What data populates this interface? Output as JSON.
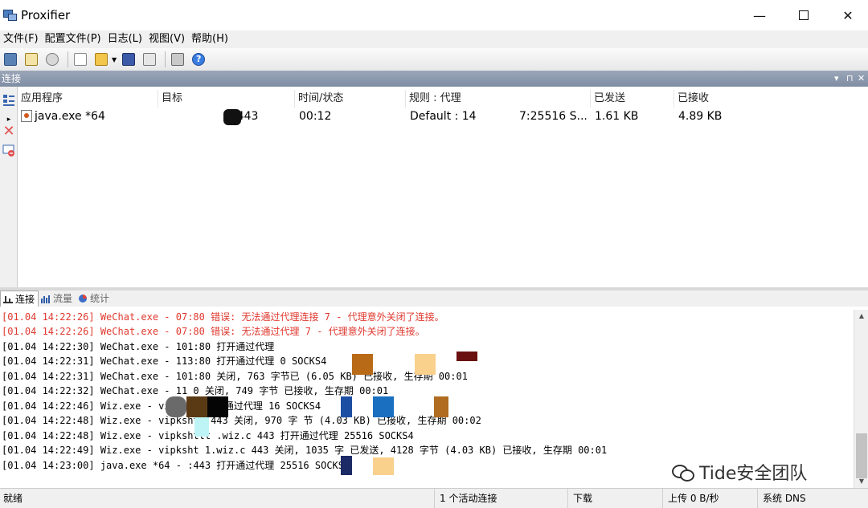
{
  "window": {
    "title": "Proxifier",
    "minimize": "—",
    "close": "✕"
  },
  "menu": [
    {
      "label": "文件(F)"
    },
    {
      "label": "配置文件(P)"
    },
    {
      "label": "日志(L)"
    },
    {
      "label": "视图(V)"
    },
    {
      "label": "帮助(H)"
    }
  ],
  "toolbar": {
    "icons": [
      "proxy-servers-icon",
      "rules-icon",
      "name-resolution-icon",
      "new-profile-icon",
      "open-profile-icon",
      "save-icon",
      "advanced-settings-icon",
      "print-icon",
      "help-icon"
    ],
    "help_glyph": "?"
  },
  "pane": {
    "title": "连接",
    "menu_glyph": "▾",
    "pin_glyph": "⊓",
    "close_glyph": "✕"
  },
  "connections": {
    "headers": [
      "应用程序",
      "目标",
      "时间/状态",
      "规则 : 代理",
      "已发送",
      "已接收"
    ],
    "rows": [
      {
        "expand": "▸",
        "app": "java.exe *64",
        "target": ":443",
        "time": "00:12",
        "rule": "Default : 14",
        "rule_tail": "7:25516 S...",
        "sent": "1.61 KB",
        "received": "4.89 KB"
      }
    ]
  },
  "tabs": [
    {
      "label": "连接",
      "active": true
    },
    {
      "label": "流量",
      "active": false
    },
    {
      "label": "统计",
      "active": false
    }
  ],
  "log": [
    {
      "text": "[01.04 14:22:26] WeChat.exe -              07:80 错误: 无法通过代理连接              7 - 代理意外关闭了连接。",
      "error": true
    },
    {
      "text": "[01.04 14:22:26] WeChat.exe -              07:80 错误: 无法通过代理              7 - 代理意外关闭了连接。",
      "error": true
    },
    {
      "text": "[01.04 14:22:30] WeChat.exe -           101:80 打开通过代理",
      "error": false
    },
    {
      "text": "[01.04 14:22:31] WeChat.exe -           113:80 打开通过代理                      0 SOCKS4",
      "error": false
    },
    {
      "text": "[01.04 14:22:31] WeChat.exe -           101:80 关闭, 763 字节已                   (6.05 KB) 已接收, 生存期 00:01",
      "error": false
    },
    {
      "text": "[01.04 14:22:32] WeChat.exe -           11  0 关闭, 749 字节                   已接收, 生存期 00:01",
      "error": false
    },
    {
      "text": "[01.04 14:22:46] Wiz.exe - vip          443 打开通过代理                       16 SOCKS4",
      "error": false
    },
    {
      "text": "[01.04 14:22:48] Wiz.exe - vipkshtt        443 关闭, 970 字                    节 (4.03 KB) 已接收, 生存期 00:02",
      "error": false
    },
    {
      "text": "[01.04 14:22:48] Wiz.exe - vipkshttt .wiz.c  443 打开通过代理                  25516 SOCKS4",
      "error": false
    },
    {
      "text": "[01.04 14:22:49] Wiz.exe - vipksht  1.wiz.c  443 关闭, 1035 字              已发送, 4128 字节 (4.03 KB) 已接收, 生存期 00:01",
      "error": false
    },
    {
      "text": "[01.04 14:23:00] java.exe *64 -           :443 打开通过代理                   25516 SOCKS4",
      "error": false
    }
  ],
  "status": {
    "ready": "就绪",
    "active": "1 个活动连接",
    "download": "下载",
    "upload": "上传 0 B/秒",
    "dns": "系统 DNS"
  },
  "watermark": "Tide安全团队"
}
